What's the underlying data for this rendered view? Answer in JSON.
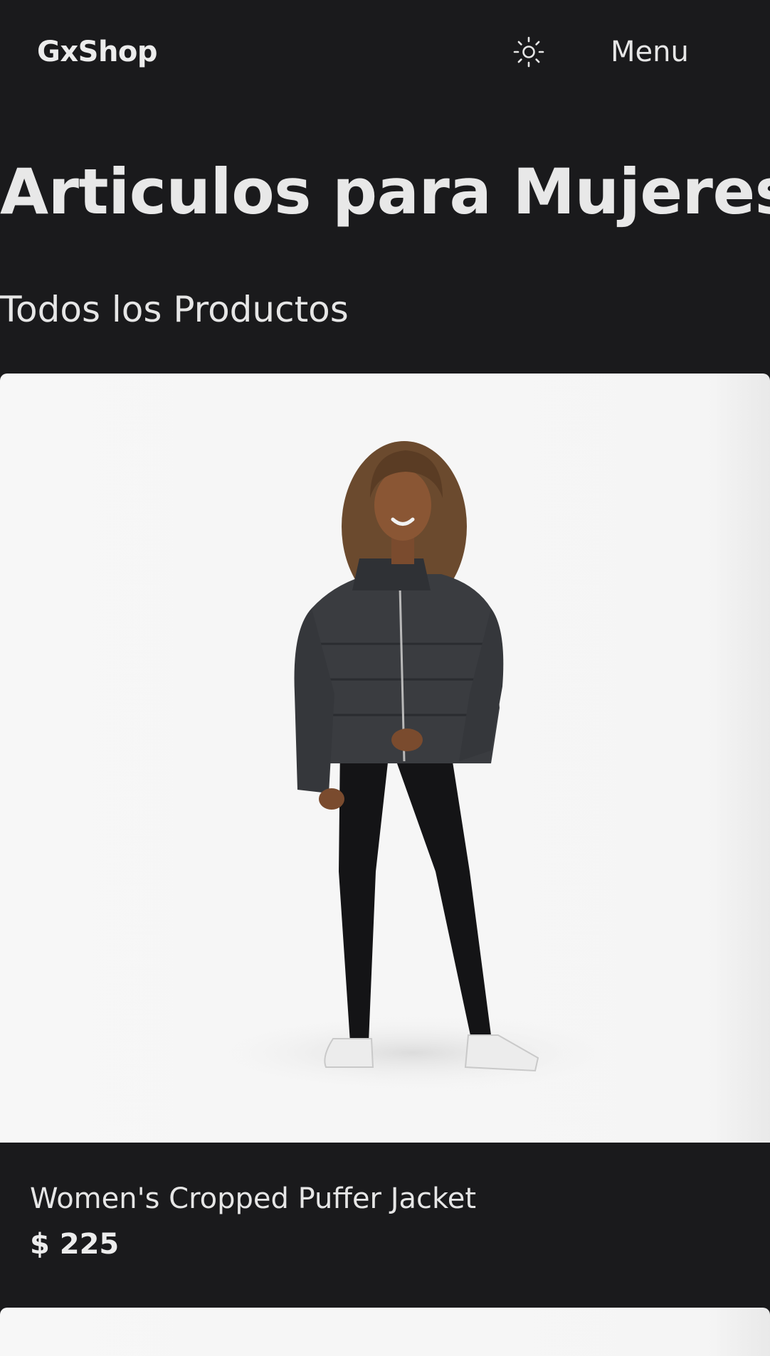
{
  "header": {
    "logo": "GxShop",
    "theme_icon": "sun-icon",
    "menu_label": "Menu"
  },
  "page": {
    "title": "Articulos para Mujeres",
    "section_title": "Todos los Productos"
  },
  "products": [
    {
      "name": "Women's Cropped Puffer Jacket",
      "price": "$ 225",
      "image": "woman-in-black-cropped-puffer-jacket-photo"
    }
  ],
  "colors": {
    "background": "#1a1a1c",
    "text": "#e6e6e6",
    "card_image_bg": "#f6f6f6"
  }
}
